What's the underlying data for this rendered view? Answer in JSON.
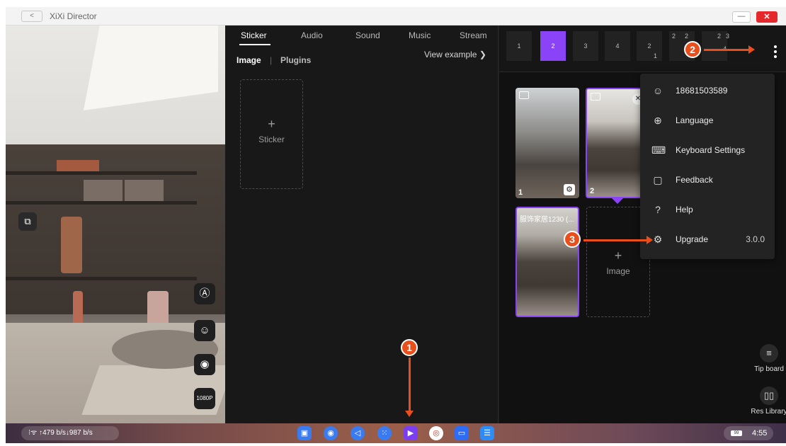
{
  "window": {
    "title": "XiXi Director",
    "back_label": "<",
    "minimize_label": "—",
    "close_label": "✕"
  },
  "preview": {
    "side_icons": [
      "layout-switch-icon",
      "auto-icon",
      "beauty-icon",
      "record-icon"
    ],
    "resolution_label": "1080P"
  },
  "tabs": [
    "Sticker",
    "Audio",
    "Sound",
    "Music",
    "Stream"
  ],
  "active_tab": "Sticker",
  "subtabs": {
    "image": "Image",
    "divider": "|",
    "plugins": "Plugins"
  },
  "view_example": "View example  ❯",
  "sticker_tile": {
    "plus": "+",
    "label": "Sticker"
  },
  "scenes": {
    "items": [
      "1",
      "2",
      "3",
      "4",
      "2",
      "",
      ""
    ],
    "active": "2",
    "extra_numbers": {
      "s5_bottom": "1",
      "s6_top": "2",
      "s6_mid": "3",
      "s7_top_a": "2",
      "s7_top_b": "3",
      "s7_mid": "4",
      "s4_top": "2"
    }
  },
  "sources": [
    {
      "num": "1",
      "caption": ""
    },
    {
      "num": "2",
      "caption": ""
    },
    {
      "num": "",
      "caption": "服饰家居1230 (..."
    }
  ],
  "image_tile": {
    "plus": "+",
    "label": "Image"
  },
  "menu": {
    "items": [
      {
        "icon": "user-circle-icon",
        "label": "18681503589"
      },
      {
        "icon": "globe-icon",
        "label": "Language"
      },
      {
        "icon": "keyboard-icon",
        "label": "Keyboard Settings"
      },
      {
        "icon": "feedback-icon",
        "label": "Feedback"
      },
      {
        "icon": "help-icon",
        "label": "Help"
      },
      {
        "icon": "gear-icon",
        "label": "Upgrade"
      }
    ],
    "version": "3.0.0"
  },
  "side_tools": {
    "tip_board": "Tip board",
    "res_library": "Res Library"
  },
  "taskbar": {
    "network": "⁝ᯤ ↑479 b/s↓987 b/s",
    "battery": "99",
    "time": "4:55"
  },
  "callouts": [
    "1",
    "2",
    "3"
  ],
  "colors": {
    "accent": "#8b43f7",
    "callout": "#e94f1c",
    "panel_bg": "#181818"
  }
}
